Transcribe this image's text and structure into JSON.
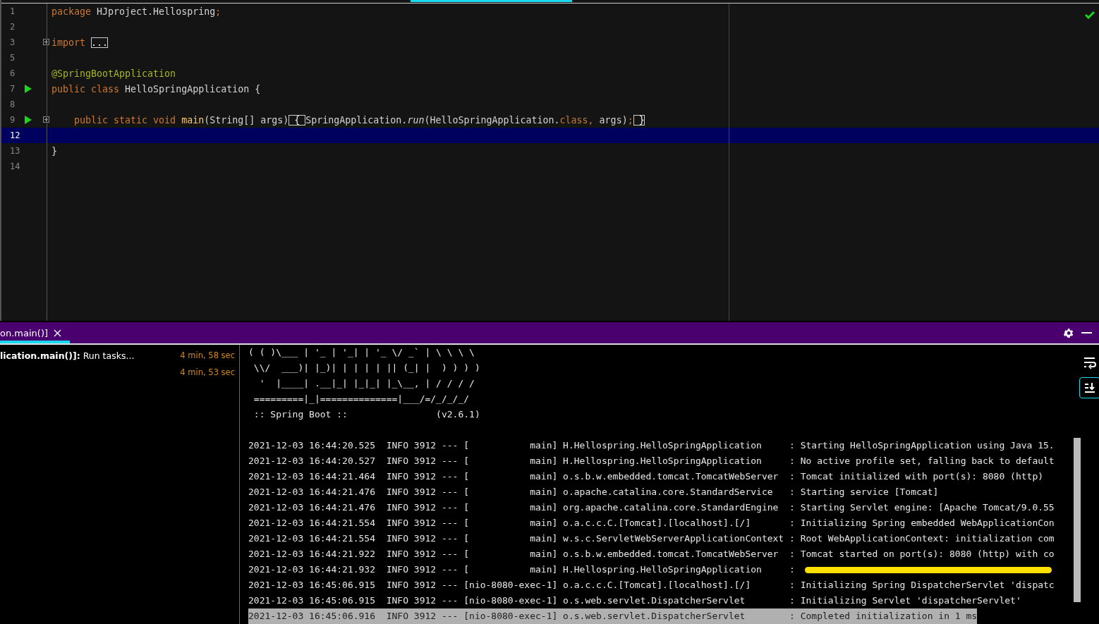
{
  "editor": {
    "lines": [
      {
        "number": "1",
        "run": false,
        "fold": false,
        "current": false,
        "tokens": [
          {
            "kind": "keyword",
            "text": "package"
          },
          {
            "kind": "plain",
            "text": " HJproject.Hellospring"
          },
          {
            "kind": "keyword",
            "text": ";"
          }
        ]
      },
      {
        "number": "2",
        "run": false,
        "fold": false,
        "current": false
      },
      {
        "number": "3",
        "run": false,
        "fold": true,
        "current": false,
        "tokens": [
          {
            "kind": "keyword",
            "text": "import "
          },
          {
            "kind": "boxed",
            "text": "..."
          }
        ]
      },
      {
        "number": "5",
        "run": false,
        "fold": false,
        "current": false
      },
      {
        "number": "6",
        "run": false,
        "fold": false,
        "current": false,
        "tokens": [
          {
            "kind": "annotation",
            "text": "@SpringBootApplication"
          }
        ]
      },
      {
        "number": "7",
        "run": true,
        "fold": false,
        "current": false,
        "tokens": [
          {
            "kind": "keyword",
            "text": "public class "
          },
          {
            "kind": "plain",
            "text": "HelloSpringApplication {"
          }
        ]
      },
      {
        "number": "8",
        "run": false,
        "fold": false,
        "current": false
      },
      {
        "number": "9",
        "run": true,
        "fold": true,
        "current": false,
        "tokens": [
          {
            "kind": "keyword",
            "text": "    public static void "
          },
          {
            "kind": "function",
            "text": "main"
          },
          {
            "kind": "plain",
            "text": "(String[] args)"
          },
          {
            "kind": "boxed",
            "text": " { "
          },
          {
            "kind": "plain",
            "text": "SpringApplication."
          },
          {
            "kind": "italic",
            "text": "run"
          },
          {
            "kind": "plain",
            "text": "(HelloSpringApplication."
          },
          {
            "kind": "keyword",
            "text": "class, "
          },
          {
            "kind": "plain",
            "text": "args)"
          },
          {
            "kind": "keyword",
            "text": ";"
          },
          {
            "kind": "boxed",
            "text": " }"
          }
        ]
      },
      {
        "number": "12",
        "run": false,
        "fold": false,
        "current": true
      },
      {
        "number": "13",
        "run": false,
        "fold": false,
        "current": false,
        "tokens": [
          {
            "kind": "plain",
            "text": "}"
          }
        ]
      },
      {
        "number": "14",
        "run": false,
        "fold": false,
        "current": false
      }
    ],
    "status_ok": true
  },
  "run_panel": {
    "tab": {
      "label": "on.main()]",
      "selected": true
    },
    "tree": [
      {
        "text": "**lication.main()]:** Run tasks...",
        "time": "4 min, 58 sec"
      },
      {
        "time": "4 min, 53 sec"
      }
    ],
    "banner": [
      "( ( )\\___ | '_ | '_| | '_ \\/ _` | \\ \\ \\ \\",
      " \\\\/  ___)| |_)| | | | | || (_| |  ) ) ) )",
      "  '  |____| .__|_| |_|_| |_\\__, | / / / /",
      " =========|_|==============|___/=/_/_/_/",
      " :: Spring Boot ::                (v2.6.1)"
    ],
    "log": [
      {
        "text": "2021-12-03 16:44:20.525  INFO 3912 --- [           main] H.Hellospring.HelloSpringApplication     : Starting HelloSpringApplication using Java 15.",
        "selected": false,
        "struck": false
      },
      {
        "text": "2021-12-03 16:44:20.527  INFO 3912 --- [           main] H.Hellospring.HelloSpringApplication     : No active profile set, falling back to default",
        "selected": false,
        "struck": false
      },
      {
        "text": "2021-12-03 16:44:21.464  INFO 3912 --- [           main] o.s.b.w.embedded.tomcat.TomcatWebServer  : Tomcat initialized with port(s): 8080 (http)",
        "selected": false,
        "struck": false
      },
      {
        "text": "2021-12-03 16:44:21.476  INFO 3912 --- [           main] o.apache.catalina.core.StandardService   : Starting service [Tomcat]",
        "selected": false,
        "struck": false
      },
      {
        "text": "2021-12-03 16:44:21.476  INFO 3912 --- [           main] org.apache.catalina.core.StandardEngine  : Starting Servlet engine: [Apache Tomcat/9.0.55",
        "selected": false,
        "struck": false
      },
      {
        "text": "2021-12-03 16:44:21.554  INFO 3912 --- [           main] o.a.c.c.C.[Tomcat].[localhost].[/]       : Initializing Spring embedded WebApplicationCon",
        "selected": false,
        "struck": false
      },
      {
        "text": "2021-12-03 16:44:21.554  INFO 3912 --- [           main] w.s.c.ServletWebServerApplicationContext : Root WebApplicationContext: initialization com",
        "selected": false,
        "struck": false
      },
      {
        "text": "2021-12-03 16:44:21.922  INFO 3912 --- [           main] o.s.b.w.embedded.tomcat.TomcatWebServer  : Tomcat started on port(s): 8080 (http) with co",
        "selected": false,
        "struck": false
      },
      {
        "text": "2021-12-03 16:44:21.932  INFO 3912 --- [           main] H.Hellospring.HelloSpringApplication     :",
        "selected": false,
        "struck": true
      },
      {
        "text": "2021-12-03 16:45:06.915  INFO 3912 --- [nio-8080-exec-1] o.a.c.c.C.[Tomcat].[localhost].[/]       : Initializing Spring DispatcherServlet 'dispatc",
        "selected": false,
        "struck": false
      },
      {
        "text": "2021-12-03 16:45:06.915  INFO 3912 --- [nio-8080-exec-1] o.s.web.servlet.DispatcherServlet        : Initializing Servlet 'dispatcherServlet'",
        "selected": false,
        "struck": false
      },
      {
        "text": "2021-12-03 16:45:06.916  INFO 3912 --- [nio-8080-exec-1] o.s.web.servlet.DispatcherServlet        : Completed initialization in 1 ms",
        "selected": true,
        "struck": false
      }
    ],
    "tools": [
      {
        "kind": "wrap",
        "on": false
      },
      {
        "kind": "scroll-end",
        "on": true
      }
    ]
  }
}
